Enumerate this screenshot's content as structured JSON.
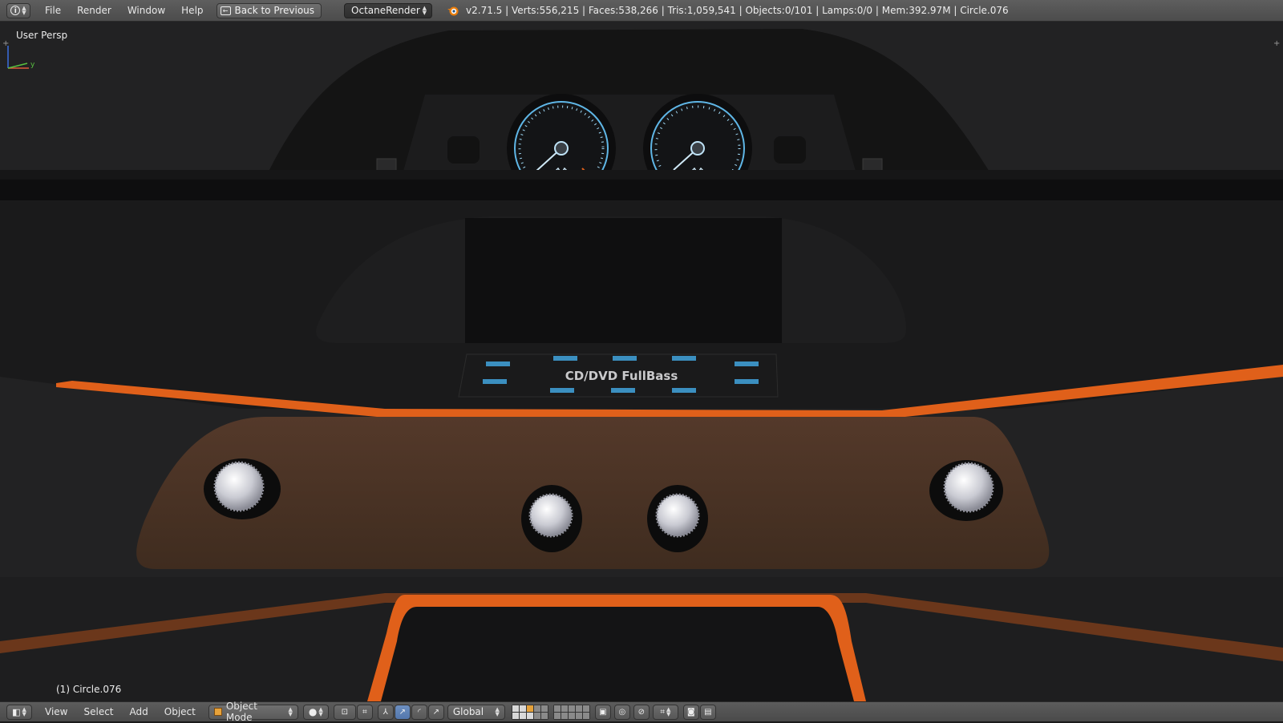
{
  "top_header": {
    "menus": [
      "File",
      "Render",
      "Window",
      "Help"
    ],
    "back_button": "Back to Previous",
    "render_engine": "OctaneRender",
    "stats": "v2.71.5 | Verts:556,215 | Faces:538,266 | Tris:1,059,541 | Objects:0/101 | Lamps:0/0 | Mem:392.97M | Circle.076"
  },
  "viewport": {
    "view_name": "User Persp",
    "active_object": "(1) Circle.076",
    "radio_label": "CD/DVD FullBass",
    "colors": {
      "orange_trim": "#e0601a",
      "wood_panel": "#4a3222",
      "gauge_ring": "#5fb6e6"
    }
  },
  "bottom_header": {
    "menus": [
      "View",
      "Select",
      "Add",
      "Object"
    ],
    "mode": "Object Mode",
    "orientation": "Global"
  }
}
